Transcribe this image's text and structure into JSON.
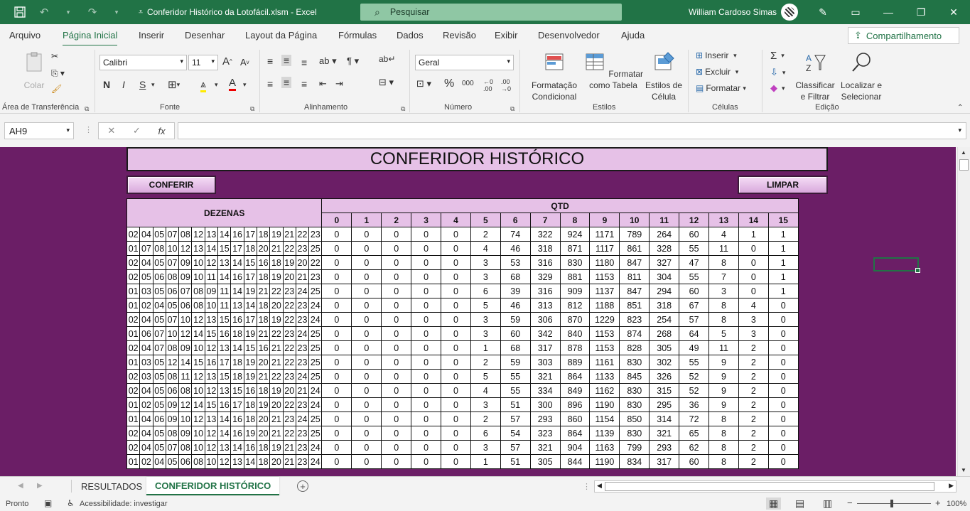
{
  "titlebar": {
    "title": "Conferidor Histórico da Lotofácil.xlsm  -  Excel",
    "search_placeholder": "Pesquisar",
    "user": "William Cardoso Simas"
  },
  "menu": {
    "tabs": [
      "Arquivo",
      "Página Inicial",
      "Inserir",
      "Desenhar",
      "Layout da Página",
      "Fórmulas",
      "Dados",
      "Revisão",
      "Exibir",
      "Desenvolvedor",
      "Ajuda"
    ],
    "active": "Página Inicial",
    "share_label": "Compartilhamento"
  },
  "ribbon": {
    "groups": [
      "Área de Transferência",
      "Fonte",
      "Alinhamento",
      "Número",
      "Estilos",
      "Células",
      "Edição"
    ],
    "paste_label": "Colar",
    "font_name": "Calibri",
    "font_size": "11",
    "bold": "N",
    "italic": "I",
    "underline": "S",
    "number_format": "Geral",
    "cond_format": "Formatação Condicional",
    "format_table": "Formatar como Tabela",
    "cell_styles": "Estilos de Célula",
    "insert": "Inserir",
    "delete": "Excluir",
    "format": "Formatar",
    "sort_filter": "Classificar e Filtrar",
    "find_select": "Localizar e Selecionar"
  },
  "formula_bar": {
    "name_box": "AH9",
    "formula": ""
  },
  "sheet": {
    "title": "CONFERIDOR HISTÓRICO",
    "btn_conferir": "CONFERIR",
    "btn_limpar": "LIMPAR",
    "header_dezenas": "DEZENAS",
    "header_qtd": "QTD",
    "qtd_cols": [
      "0",
      "1",
      "2",
      "3",
      "4",
      "5",
      "6",
      "7",
      "8",
      "9",
      "10",
      "11",
      "12",
      "13",
      "14",
      "15"
    ],
    "rows": [
      {
        "d": [
          "02",
          "04",
          "05",
          "07",
          "08",
          "12",
          "13",
          "14",
          "16",
          "17",
          "18",
          "19",
          "21",
          "22",
          "23"
        ],
        "q": [
          "0",
          "0",
          "0",
          "0",
          "0",
          "2",
          "74",
          "322",
          "924",
          "1171",
          "789",
          "264",
          "60",
          "4",
          "1",
          "1"
        ]
      },
      {
        "d": [
          "01",
          "07",
          "08",
          "10",
          "12",
          "13",
          "14",
          "15",
          "17",
          "18",
          "20",
          "21",
          "22",
          "23",
          "25"
        ],
        "q": [
          "0",
          "0",
          "0",
          "0",
          "0",
          "4",
          "46",
          "318",
          "871",
          "1117",
          "861",
          "328",
          "55",
          "11",
          "0",
          "1"
        ]
      },
      {
        "d": [
          "02",
          "04",
          "05",
          "07",
          "09",
          "10",
          "12",
          "13",
          "14",
          "15",
          "16",
          "18",
          "19",
          "20",
          "22"
        ],
        "q": [
          "0",
          "0",
          "0",
          "0",
          "0",
          "3",
          "53",
          "316",
          "830",
          "1180",
          "847",
          "327",
          "47",
          "8",
          "0",
          "1"
        ]
      },
      {
        "d": [
          "02",
          "05",
          "06",
          "08",
          "09",
          "10",
          "11",
          "14",
          "16",
          "17",
          "18",
          "19",
          "20",
          "21",
          "23"
        ],
        "q": [
          "0",
          "0",
          "0",
          "0",
          "0",
          "3",
          "68",
          "329",
          "881",
          "1153",
          "811",
          "304",
          "55",
          "7",
          "0",
          "1"
        ]
      },
      {
        "d": [
          "01",
          "03",
          "05",
          "06",
          "07",
          "08",
          "09",
          "11",
          "14",
          "19",
          "21",
          "22",
          "23",
          "24",
          "25"
        ],
        "q": [
          "0",
          "0",
          "0",
          "0",
          "0",
          "6",
          "39",
          "316",
          "909",
          "1137",
          "847",
          "294",
          "60",
          "3",
          "0",
          "1"
        ]
      },
      {
        "d": [
          "01",
          "02",
          "04",
          "05",
          "06",
          "08",
          "10",
          "11",
          "13",
          "14",
          "18",
          "20",
          "22",
          "23",
          "24"
        ],
        "q": [
          "0",
          "0",
          "0",
          "0",
          "0",
          "5",
          "46",
          "313",
          "812",
          "1188",
          "851",
          "318",
          "67",
          "8",
          "4",
          "0"
        ]
      },
      {
        "d": [
          "02",
          "04",
          "05",
          "07",
          "10",
          "12",
          "13",
          "15",
          "16",
          "17",
          "18",
          "19",
          "22",
          "23",
          "24"
        ],
        "q": [
          "0",
          "0",
          "0",
          "0",
          "0",
          "3",
          "59",
          "306",
          "870",
          "1229",
          "823",
          "254",
          "57",
          "8",
          "3",
          "0"
        ]
      },
      {
        "d": [
          "01",
          "06",
          "07",
          "10",
          "12",
          "14",
          "15",
          "16",
          "18",
          "19",
          "21",
          "22",
          "23",
          "24",
          "25"
        ],
        "q": [
          "0",
          "0",
          "0",
          "0",
          "0",
          "3",
          "60",
          "342",
          "840",
          "1153",
          "874",
          "268",
          "64",
          "5",
          "3",
          "0"
        ]
      },
      {
        "d": [
          "02",
          "04",
          "07",
          "08",
          "09",
          "10",
          "12",
          "13",
          "14",
          "15",
          "16",
          "21",
          "22",
          "23",
          "25"
        ],
        "q": [
          "0",
          "0",
          "0",
          "0",
          "0",
          "1",
          "68",
          "317",
          "878",
          "1153",
          "828",
          "305",
          "49",
          "11",
          "2",
          "0"
        ]
      },
      {
        "d": [
          "01",
          "03",
          "05",
          "12",
          "14",
          "15",
          "16",
          "17",
          "18",
          "19",
          "20",
          "21",
          "22",
          "23",
          "25"
        ],
        "q": [
          "0",
          "0",
          "0",
          "0",
          "0",
          "2",
          "59",
          "303",
          "889",
          "1161",
          "830",
          "302",
          "55",
          "9",
          "2",
          "0"
        ]
      },
      {
        "d": [
          "02",
          "03",
          "05",
          "08",
          "11",
          "12",
          "13",
          "15",
          "18",
          "19",
          "21",
          "22",
          "23",
          "24",
          "25"
        ],
        "q": [
          "0",
          "0",
          "0",
          "0",
          "0",
          "5",
          "55",
          "321",
          "864",
          "1133",
          "845",
          "326",
          "52",
          "9",
          "2",
          "0"
        ]
      },
      {
        "d": [
          "02",
          "04",
          "05",
          "06",
          "08",
          "10",
          "12",
          "13",
          "15",
          "16",
          "18",
          "19",
          "20",
          "21",
          "24"
        ],
        "q": [
          "0",
          "0",
          "0",
          "0",
          "0",
          "4",
          "55",
          "334",
          "849",
          "1162",
          "830",
          "315",
          "52",
          "9",
          "2",
          "0"
        ]
      },
      {
        "d": [
          "01",
          "02",
          "05",
          "09",
          "12",
          "14",
          "15",
          "16",
          "17",
          "18",
          "19",
          "20",
          "22",
          "23",
          "24"
        ],
        "q": [
          "0",
          "0",
          "0",
          "0",
          "0",
          "3",
          "51",
          "300",
          "896",
          "1190",
          "830",
          "295",
          "36",
          "9",
          "2",
          "0"
        ]
      },
      {
        "d": [
          "01",
          "04",
          "06",
          "09",
          "10",
          "12",
          "13",
          "14",
          "16",
          "18",
          "20",
          "21",
          "23",
          "24",
          "25"
        ],
        "q": [
          "0",
          "0",
          "0",
          "0",
          "0",
          "2",
          "57",
          "293",
          "860",
          "1154",
          "850",
          "314",
          "72",
          "8",
          "2",
          "0"
        ]
      },
      {
        "d": [
          "02",
          "04",
          "05",
          "08",
          "09",
          "10",
          "12",
          "14",
          "16",
          "19",
          "20",
          "21",
          "22",
          "23",
          "25"
        ],
        "q": [
          "0",
          "0",
          "0",
          "0",
          "0",
          "6",
          "54",
          "323",
          "864",
          "1139",
          "830",
          "321",
          "65",
          "8",
          "2",
          "0"
        ]
      },
      {
        "d": [
          "02",
          "04",
          "05",
          "07",
          "08",
          "10",
          "12",
          "13",
          "14",
          "16",
          "18",
          "19",
          "21",
          "23",
          "24"
        ],
        "q": [
          "0",
          "0",
          "0",
          "0",
          "0",
          "3",
          "57",
          "321",
          "904",
          "1163",
          "799",
          "293",
          "62",
          "8",
          "2",
          "0"
        ]
      },
      {
        "d": [
          "01",
          "02",
          "04",
          "05",
          "06",
          "08",
          "10",
          "12",
          "13",
          "14",
          "18",
          "20",
          "21",
          "23",
          "24"
        ],
        "q": [
          "0",
          "0",
          "0",
          "0",
          "0",
          "1",
          "51",
          "305",
          "844",
          "1190",
          "834",
          "317",
          "60",
          "8",
          "2",
          "0"
        ]
      }
    ],
    "bg_color": "#6b1e66",
    "header_color": "#e6c1e7"
  },
  "sheet_tabs": {
    "tabs": [
      "RESULTADOS",
      "CONFERIDOR HISTÓRICO"
    ],
    "active": "CONFERIDOR HISTÓRICO"
  },
  "status": {
    "ready": "Pronto",
    "accessibility": "Acessibilidade: investigar",
    "zoom": "100%"
  }
}
